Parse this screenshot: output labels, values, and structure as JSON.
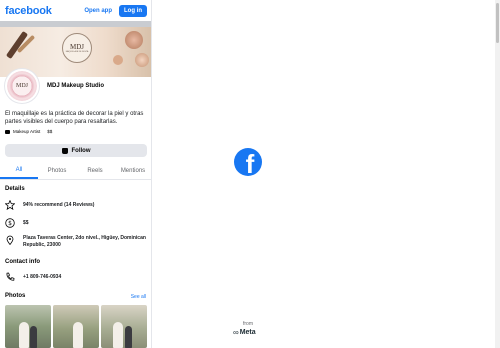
{
  "header": {
    "brand": "facebook",
    "open_app_label": "Open app",
    "login_label": "Log in"
  },
  "cover": {
    "logo_text": "MDJ",
    "logo_sub": "MAQUILLAJE DE NOVIA"
  },
  "profile": {
    "avatar_text": "MDJ",
    "name": "MDJ Makeup Studio",
    "bio": "El maquillaje es la práctica de decorar la piel y otras partes visibles del cuerpo para resaltarlas.",
    "category": "Makeup Artist",
    "price": "$$",
    "follow_label": "Follow"
  },
  "tabs": [
    {
      "label": "All",
      "active": true
    },
    {
      "label": "Photos",
      "active": false
    },
    {
      "label": "Reels",
      "active": false
    },
    {
      "label": "Mentions",
      "active": false
    }
  ],
  "details": {
    "title": "Details",
    "recommend": "94% recommend (14 Reviews)",
    "price": "$$",
    "address": "Plaza Taveras Center, 2do nivel., Higüey, Dominican Republic, 23000"
  },
  "contact": {
    "title": "Contact info",
    "phone": "+1 809-746-0934"
  },
  "photos": {
    "title": "Photos",
    "see_all": "See all"
  },
  "right_panel": {
    "from_label": "from",
    "meta_label": "Meta",
    "brand_color": "#1877f2"
  },
  "icons": [
    "facebook-logo-icon",
    "star-icon",
    "dollar-icon",
    "location-pin-icon",
    "phone-icon",
    "category-icon",
    "follow-icon",
    "meta-logo-icon"
  ]
}
